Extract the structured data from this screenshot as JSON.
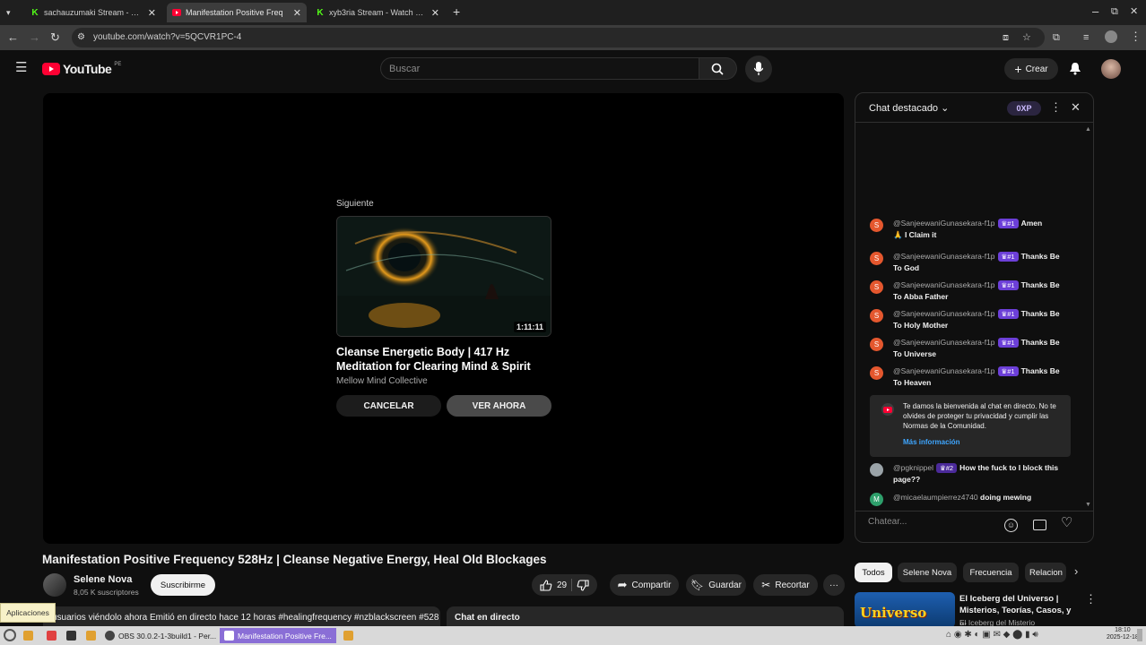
{
  "browser": {
    "tabs": [
      {
        "title": "sachauzumaki Stream - Watc",
        "icon": "kick-icon",
        "active": false
      },
      {
        "title": "Manifestation Positive Freq",
        "icon": "youtube-icon",
        "active": true
      },
      {
        "title": "xyb3ria Stream - Watch Live",
        "icon": "kick-icon",
        "active": false
      }
    ],
    "new_tab": "+",
    "url": "youtube.com/watch?v=5QCVR1PC-4"
  },
  "youtube": {
    "logo_text": "YouTube",
    "country": "PE",
    "search_placeholder": "Buscar",
    "create_label": "Crear"
  },
  "player": {
    "up_next_label": "Siguiente",
    "next_video": {
      "title": "Cleanse Energetic Body | 417 Hz Meditation for Clearing Mind & Spirit",
      "channel": "Mellow Mind Collective",
      "duration": "1:11:11"
    },
    "cancel_label": "CANCELAR",
    "watch_now_label": "VER AHORA"
  },
  "video": {
    "title": "Manifestation Positive Frequency 528Hz | Cleanse Negative Energy, Heal Old Blockages",
    "channel": "Selene Nova",
    "subscribers": "8,05 K suscriptores",
    "subscribe_label": "Suscribirme",
    "likes": "29",
    "share_label": "Compartir",
    "save_label": "Guardar",
    "clip_label": "Recortar",
    "more": "···",
    "description_line": "usuarios viéndolo ahora  Emitió en directo hace 12 horas  #healingfrequency #nzblackscreen #528",
    "live_chat_label": "Chat en directo"
  },
  "tooltip": "Aplicaciones",
  "chat": {
    "title": "Chat destacado",
    "xp": "0XP",
    "messages": [
      {
        "initial": "S",
        "author": "@SanjeewaniGunasekara-f1p",
        "badge": "#1",
        "text": "Amen",
        "text2": "🙏 I Claim it"
      },
      {
        "initial": "S",
        "author": "@SanjeewaniGunasekara-f1p",
        "badge": "#1",
        "text": "Thanks Be",
        "text2": "To God"
      },
      {
        "initial": "S",
        "author": "@SanjeewaniGunasekara-f1p",
        "badge": "#1",
        "text": "Thanks Be",
        "text2": "To Abba Father"
      },
      {
        "initial": "S",
        "author": "@SanjeewaniGunasekara-f1p",
        "badge": "#1",
        "text": "Thanks Be",
        "text2": "To Holy Mother"
      },
      {
        "initial": "S",
        "author": "@SanjeewaniGunasekara-f1p",
        "badge": "#1",
        "text": "Thanks Be",
        "text2": "To Universe"
      },
      {
        "initial": "S",
        "author": "@SanjeewaniGunasekara-f1p",
        "badge": "#1",
        "text": "Thanks Be",
        "text2": "To Heaven"
      }
    ],
    "welcome_text": "Te damos la bienvenida al chat en directo. No te olvides de proteger tu privacidad y cumplir las Normas de la Comunidad.",
    "welcome_more": "Más información",
    "late_messages": [
      {
        "author": "@pgknippel",
        "badge": "#2",
        "text": "How the fuck to I block this page??"
      },
      {
        "initial": "M",
        "author": "@micaelaumpierrez4740",
        "text": "doing mewing"
      }
    ],
    "input_placeholder": "Chatear..."
  },
  "chips": [
    "Todos",
    "Selene Nova",
    "Frecuencia",
    "Relacion"
  ],
  "recommendation": {
    "title": "El Iceberg del Universo | Misterios, Teorías, Casos, y ...",
    "channel": "El Iceberg del Misterio",
    "thumb_text": "Universo"
  },
  "taskbar": {
    "items": [
      "OBS 30.0.2-1-3build1 - Per...",
      "Manifestation Positive Fre..."
    ],
    "clock": "18:10",
    "date": "2025-12-18"
  },
  "colors": {
    "accent_red": "#ff0033",
    "badge_purple": "#6c3fd8",
    "link_blue": "#3ea6ff",
    "kick_green": "#53fc18"
  }
}
